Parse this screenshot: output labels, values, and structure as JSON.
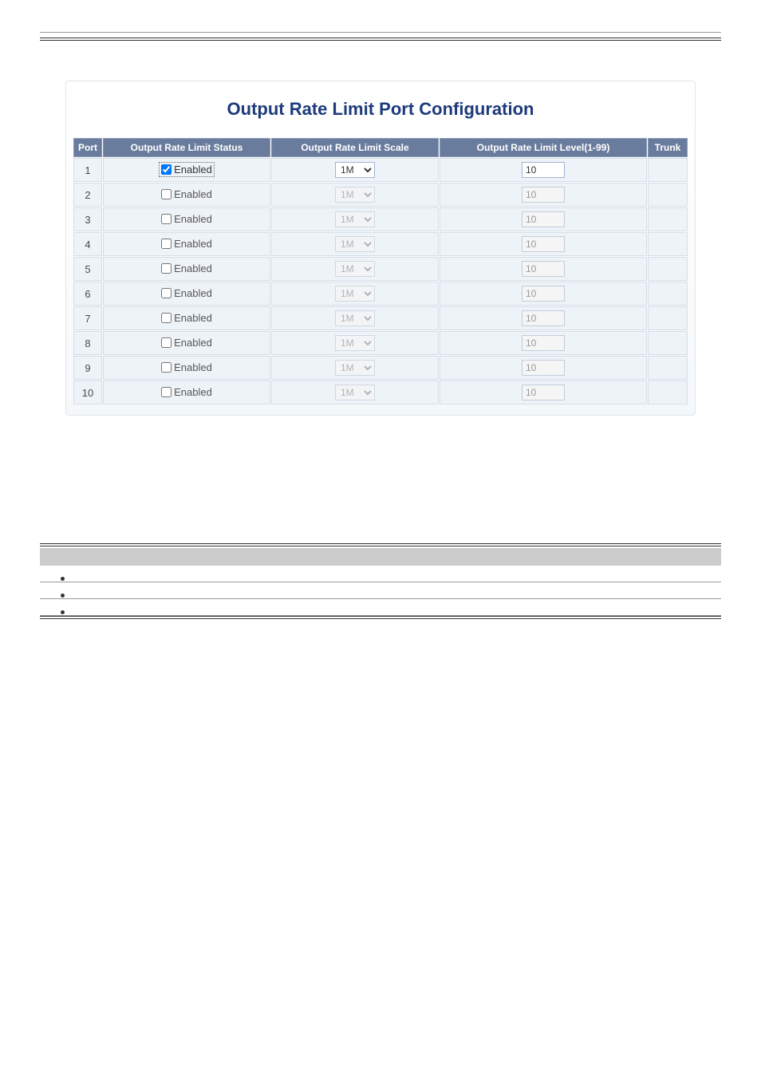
{
  "panel": {
    "title": "Output Rate Limit Port Configuration"
  },
  "table": {
    "headers": {
      "port": "Port",
      "status": "Output Rate Limit Status",
      "scale": "Output Rate Limit Scale",
      "level": "Output Rate Limit Level(1-99)",
      "trunk": "Trunk"
    },
    "checkbox_label": "Enabled",
    "scale_option": "1M",
    "rows": [
      {
        "port": "1",
        "checked": true,
        "focused": true,
        "scale": "1M",
        "scale_disabled": false,
        "level": "10",
        "level_disabled": false,
        "trunk": ""
      },
      {
        "port": "2",
        "checked": false,
        "focused": false,
        "scale": "1M",
        "scale_disabled": true,
        "level": "10",
        "level_disabled": true,
        "trunk": ""
      },
      {
        "port": "3",
        "checked": false,
        "focused": false,
        "scale": "1M",
        "scale_disabled": true,
        "level": "10",
        "level_disabled": true,
        "trunk": ""
      },
      {
        "port": "4",
        "checked": false,
        "focused": false,
        "scale": "1M",
        "scale_disabled": true,
        "level": "10",
        "level_disabled": true,
        "trunk": ""
      },
      {
        "port": "5",
        "checked": false,
        "focused": false,
        "scale": "1M",
        "scale_disabled": true,
        "level": "10",
        "level_disabled": true,
        "trunk": ""
      },
      {
        "port": "6",
        "checked": false,
        "focused": false,
        "scale": "1M",
        "scale_disabled": true,
        "level": "10",
        "level_disabled": true,
        "trunk": ""
      },
      {
        "port": "7",
        "checked": false,
        "focused": false,
        "scale": "1M",
        "scale_disabled": true,
        "level": "10",
        "level_disabled": true,
        "trunk": ""
      },
      {
        "port": "8",
        "checked": false,
        "focused": false,
        "scale": "1M",
        "scale_disabled": true,
        "level": "10",
        "level_disabled": true,
        "trunk": ""
      },
      {
        "port": "9",
        "checked": false,
        "focused": false,
        "scale": "1M",
        "scale_disabled": true,
        "level": "10",
        "level_disabled": true,
        "trunk": ""
      },
      {
        "port": "10",
        "checked": false,
        "focused": false,
        "scale": "1M",
        "scale_disabled": true,
        "level": "10",
        "level_disabled": true,
        "trunk": ""
      }
    ]
  }
}
